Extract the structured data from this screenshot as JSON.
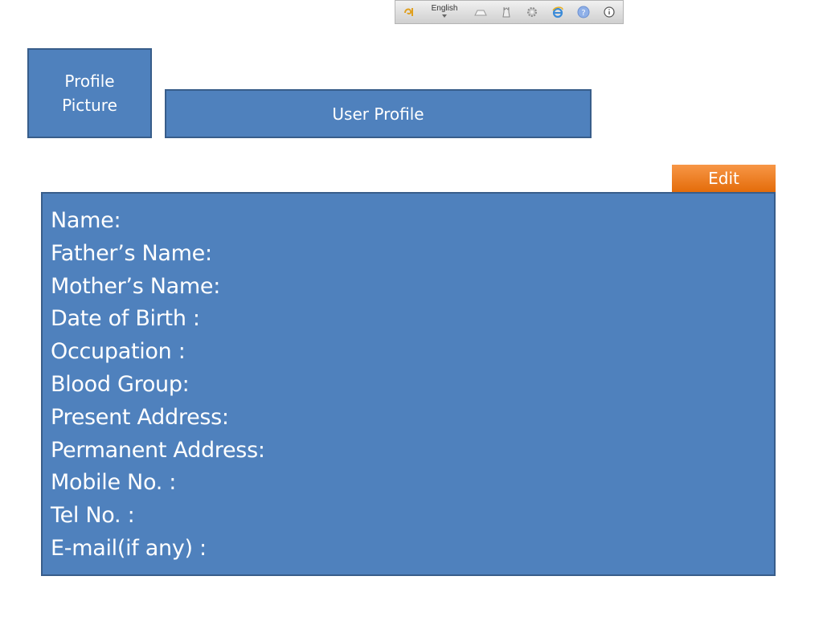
{
  "toolbar": {
    "language": "English",
    "icons": [
      "swirl-logo-icon",
      "keyboard-icon",
      "chess-piece-icon",
      "gear-icon",
      "browser-icon",
      "help-icon",
      "info-icon"
    ]
  },
  "profile_picture": {
    "label": "Profile Picture"
  },
  "header": {
    "title": "User Profile"
  },
  "actions": {
    "edit_label": "Edit"
  },
  "details": {
    "fields": [
      "Name:",
      "Father’s Name:",
      "Mother’s Name:",
      "Date of Birth :",
      "Occupation :",
      "Blood Group:",
      "Present Address:",
      "Permanent Address:",
      "Mobile No. :",
      "Tel No. :",
      "E-mail(if any) :"
    ]
  },
  "colors": {
    "panel_fill": "#4f81bd",
    "panel_border": "#385d8a",
    "edit_button": "#f79646",
    "text": "#ffffff"
  }
}
